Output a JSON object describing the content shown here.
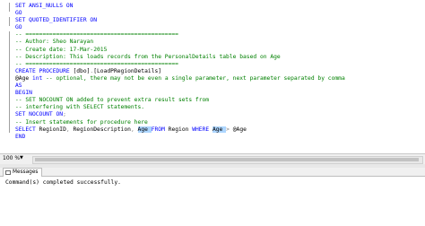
{
  "editor": {
    "lines": [
      [
        {
          "t": "SET ANSI_NULLS ON",
          "c": "kw"
        }
      ],
      [
        {
          "t": "GO",
          "c": "kw"
        }
      ],
      [
        {
          "t": "SET QUOTED_IDENTIFIER ON",
          "c": "kw"
        }
      ],
      [
        {
          "t": "GO",
          "c": "kw"
        }
      ],
      [
        {
          "t": "-- =============================================",
          "c": "cm"
        }
      ],
      [
        {
          "t": "-- Author: Sheo Narayan",
          "c": "cm"
        }
      ],
      [
        {
          "t": "-- Create date: 17-Mar-2015",
          "c": "cm"
        }
      ],
      [
        {
          "t": "-- Description: This loads records from the PersonalDetails table based on Age",
          "c": "cm"
        }
      ],
      [
        {
          "t": "-- =============================================",
          "c": "cm"
        }
      ],
      [
        {
          "t": "CREATE PROCEDURE ",
          "c": "kw"
        },
        {
          "t": "[dbo]",
          "c": "tx"
        },
        {
          "t": ".",
          "c": "op"
        },
        {
          "t": "[LoadPRegionDetails]",
          "c": "tx"
        }
      ],
      [
        {
          "t": "@Age ",
          "c": "tx"
        },
        {
          "t": "int ",
          "c": "kw"
        },
        {
          "t": "-- optional, there may not be even a single parameter, next parameter separated by comma",
          "c": "cm"
        }
      ],
      [
        {
          "t": "AS",
          "c": "kw"
        }
      ],
      [
        {
          "t": "BEGIN",
          "c": "kw"
        }
      ],
      [
        {
          "t": "-- SET NOCOUNT ON added to prevent extra result sets from",
          "c": "cm"
        }
      ],
      [
        {
          "t": "-- interfering with SELECT statements.",
          "c": "cm"
        }
      ],
      [
        {
          "t": "SET NOCOUNT ON",
          "c": "kw"
        },
        {
          "t": ";",
          "c": "op"
        }
      ],
      [
        {
          "t": "-- Insert statements for procedure here",
          "c": "cm"
        }
      ],
      [
        {
          "t": "SELECT ",
          "c": "kw"
        },
        {
          "t": "RegionID",
          "c": "tx"
        },
        {
          "t": ", ",
          "c": "op"
        },
        {
          "t": "RegionDescription",
          "c": "tx"
        },
        {
          "t": ", ",
          "c": "op"
        },
        {
          "t": "Age ",
          "c": "sel"
        },
        {
          "t": "FROM ",
          "c": "kw"
        },
        {
          "t": "Region ",
          "c": "tx"
        },
        {
          "t": "WHERE ",
          "c": "kw"
        },
        {
          "t": "Age ",
          "c": "sel"
        },
        {
          "t": "> ",
          "c": "op"
        },
        {
          "t": "@Age",
          "c": "tx"
        }
      ],
      [
        {
          "t": "END",
          "c": "kw"
        }
      ]
    ]
  },
  "status": {
    "zoom": "100 %"
  },
  "results": {
    "tab_label": "Messages",
    "message": "Command(s) completed successfully."
  },
  "colors": {
    "keyword": "#0000ff",
    "comment": "#008000",
    "operator": "#808080",
    "highlight": "#add6ff"
  }
}
